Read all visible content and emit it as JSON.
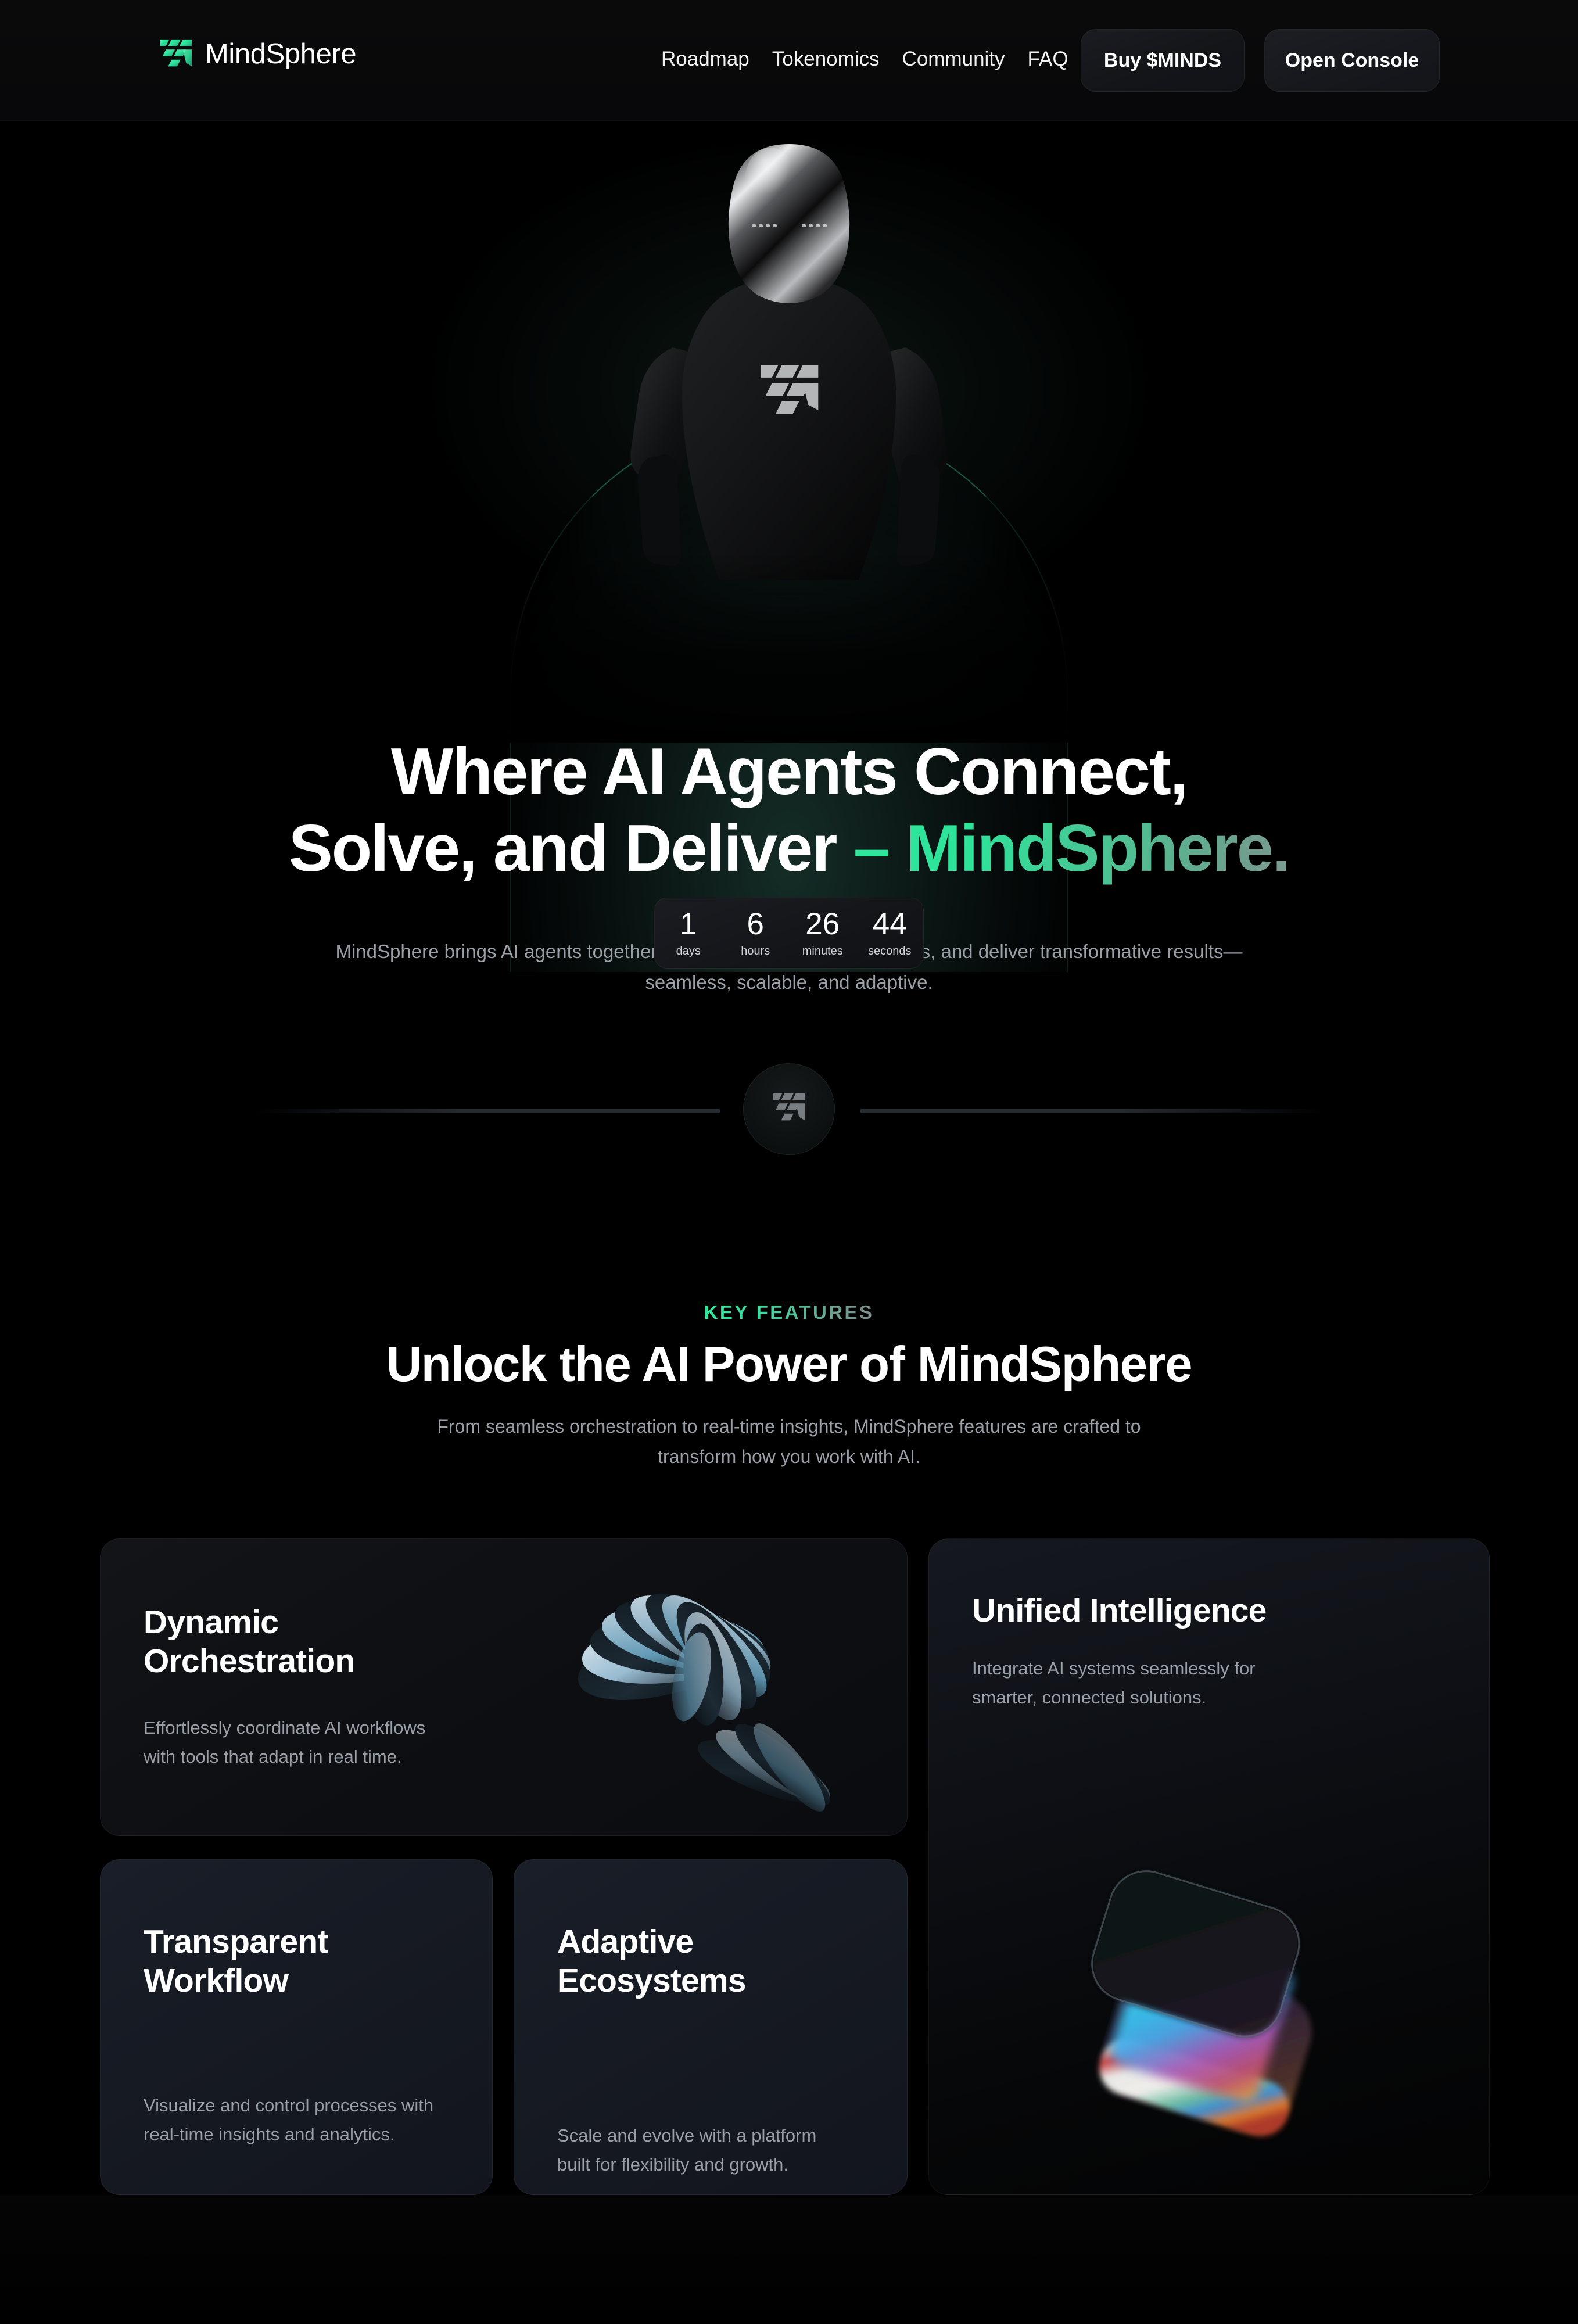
{
  "brand": {
    "name": "MindSphere",
    "logo_icon": "mindsphere-grid-logo",
    "accent": "#2EE59D"
  },
  "nav": {
    "links": [
      {
        "label": "Roadmap"
      },
      {
        "label": "Tokenomics"
      },
      {
        "label": "Community"
      },
      {
        "label": "FAQ"
      }
    ],
    "buy_label": "Buy $MINDS",
    "console_label": "Open Console"
  },
  "hero": {
    "title_line1": "Where AI Agents Connect,",
    "title_line2_plain": "Solve, and Deliver ",
    "title_line2_accent": "– MindSphere.",
    "subtitle_line1": "MindSphere brings AI agents together to collaborate, solve challenges, and deliver transformative results—",
    "subtitle_line2": "seamless, scalable, and adaptive.",
    "robot_image_alt": "humanoid-robot"
  },
  "countdown": {
    "units": [
      {
        "value": "1",
        "label": "days"
      },
      {
        "value": "6",
        "label": "hours"
      },
      {
        "value": "26",
        "label": "minutes"
      },
      {
        "value": "44",
        "label": "seconds"
      }
    ]
  },
  "divider": {
    "badge_icon": "mindsphere-grid-logo"
  },
  "features": {
    "eyebrow": "KEY FEATURES",
    "title": "Unlock the AI Power of MindSphere",
    "subtitle_line1": "From seamless orchestration to real-time insights, MindSphere",
    "subtitle_line2": "features are crafted to transform how you work with AI.",
    "cards": [
      {
        "id": "dynamic-orchestration",
        "title_line1": "Dynamic",
        "title_line2": "Orchestration",
        "body": "Effortlessly coordinate AI workflows with tools that adapt in real time.",
        "art": "spiral-discs-3d"
      },
      {
        "id": "unified-intelligence",
        "title_line1": "Unified Intelligence",
        "title_line2": "",
        "body": "Integrate AI systems seamlessly for smarter, connected solutions.",
        "art": "iridescent-glass-cube"
      },
      {
        "id": "transparent-workflow",
        "title_line1": "Transparent",
        "title_line2": "Workflow",
        "body": "Visualize and control processes with real-time insights and analytics.",
        "art": ""
      },
      {
        "id": "adaptive-ecosystems",
        "title_line1": "Adaptive",
        "title_line2": "Ecosystems",
        "body": "Scale and evolve with a platform built for flexibility and growth.",
        "art": ""
      }
    ]
  }
}
